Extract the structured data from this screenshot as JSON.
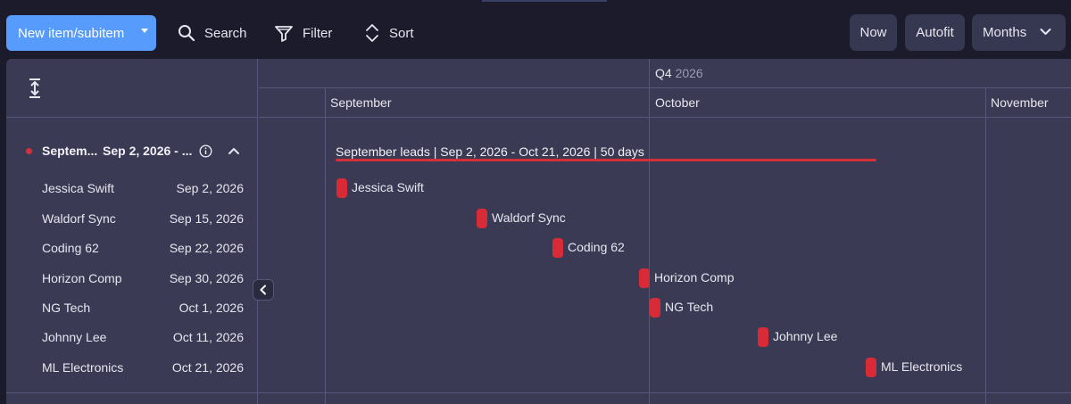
{
  "toolbar": {
    "new_label": "New item/subitem",
    "search_label": "Search",
    "filter_label": "Filter",
    "sort_label": "Sort",
    "now_label": "Now",
    "autofit_label": "Autofit",
    "zoom_label": "Months"
  },
  "timeline": {
    "quarter": "Q4",
    "quarter_year": "2026",
    "months": [
      "September",
      "October",
      "November"
    ]
  },
  "group": {
    "name": "Septem...",
    "date_range": "Sep 2, 2026 - ...",
    "color": "#d4303a",
    "summary": "September leads | Sep 2, 2026 - Oct 21, 2026 | 50 days"
  },
  "items": [
    {
      "name": "Jessica Swift",
      "date": "Sep 2, 2026"
    },
    {
      "name": "Waldorf Sync",
      "date": "Sep 15, 2026"
    },
    {
      "name": "Coding 62",
      "date": "Sep 22, 2026"
    },
    {
      "name": "Horizon Comp",
      "date": "Sep 30, 2026"
    },
    {
      "name": "NG Tech",
      "date": "Oct 1, 2026"
    },
    {
      "name": "Johnny Lee",
      "date": "Oct 11, 2026"
    },
    {
      "name": "ML Electronics",
      "date": "Oct 21, 2026"
    }
  ],
  "colors": {
    "accent": "#579bfc",
    "milestone": "#d92b37",
    "panel": "#3b3a55",
    "background": "#1b1b2b"
  }
}
